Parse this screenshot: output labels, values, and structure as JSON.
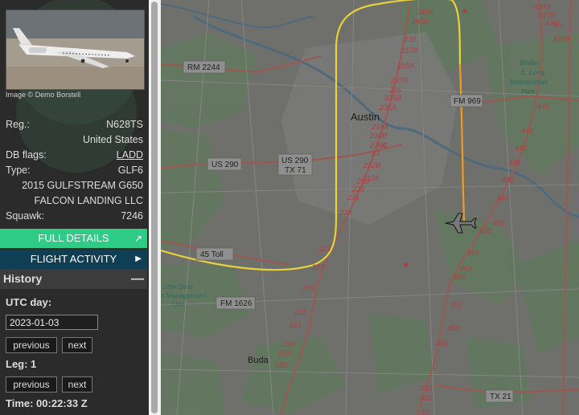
{
  "aircraft": {
    "photo_credit": "Image © Demo Borstell",
    "reg_label": "Reg.:",
    "reg": "N628TS",
    "country": "United States",
    "db_flags_label": "DB flags:",
    "db_flags": "LADD",
    "type_label": "Type:",
    "type": "GLF6",
    "description": "2015 GULFSTREAM G650",
    "owner": "FALCON LANDING LLC",
    "squawk_label": "Squawk:",
    "squawk": "7246"
  },
  "buttons": {
    "full_details": "FULL DETAILS",
    "flight_activity": "FLIGHT ACTIVITY"
  },
  "history": {
    "title": "History",
    "utc_day_label": "UTC day:",
    "date": "2023-01-03",
    "previous": "previous",
    "next": "next",
    "leg_label": "Leg: 1",
    "time_label": "Time: 00:22:33 Z"
  },
  "map": {
    "city": "Austin",
    "town_buda": "Buda",
    "road_labels": [
      "RM 2244",
      "US 290",
      "US 290",
      "TX 71",
      "45 Toll",
      "FM 1626",
      "FM 969",
      "TX 21"
    ],
    "places": [
      "Walter",
      "E. Long",
      "Metropolitan",
      "Park",
      "Little Bear",
      "k Management",
      "Unit"
    ],
    "altitudes": [
      "240A",
      "240B",
      "238",
      "237B",
      "238A",
      "237A",
      "236",
      "235B",
      "235A",
      "234A",
      "234B",
      "234C",
      "4A",
      "23",
      "232B",
      "232A",
      "230",
      "229",
      "231",
      "228",
      "227",
      "223",
      "226",
      "223",
      "221",
      "220",
      "219",
      "220",
      "437A",
      "437B",
      "436",
      "Ma",
      "437B",
      "441",
      "444",
      "446",
      "446",
      "449",
      "449",
      "450",
      "450",
      "451",
      "453",
      "455",
      "455",
      "458",
      "460",
      "460",
      "462",
      "22"
    ],
    "track_colors": {
      "yellow": "#e8d23c",
      "orange": "#f29a1e"
    }
  }
}
